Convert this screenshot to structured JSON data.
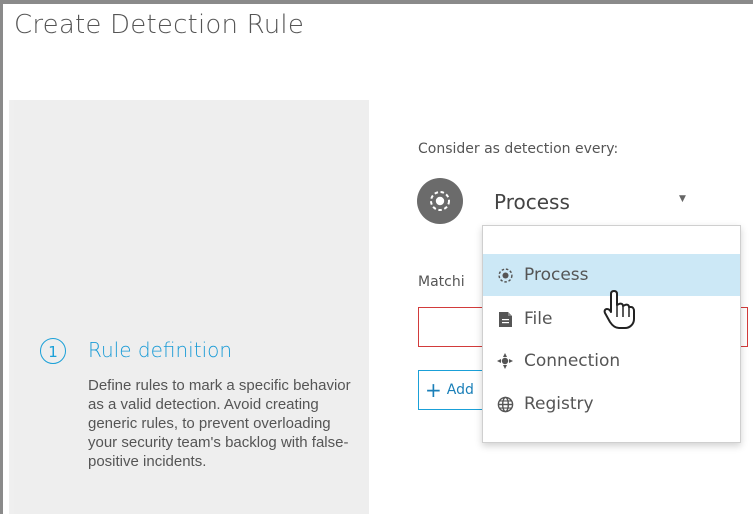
{
  "page": {
    "title": "Create Detection Rule"
  },
  "steps": [
    {
      "number": "1",
      "title": "Rule definition",
      "description": "Define rules to mark a specific behavior as a valid detection. Avoid creating generic rules, to prevent overloading your security team's backlog with false-positive incidents."
    }
  ],
  "form": {
    "consider_label": "Consider as detection every:",
    "selected_type": "Process",
    "selected_icon": "process-icon",
    "matching_label_partial": "Matchi",
    "add_label_partial": "Add"
  },
  "dropdown": {
    "options": [
      {
        "label": "Process",
        "icon": "process-icon",
        "highlighted": true
      },
      {
        "label": "File",
        "icon": "file-icon",
        "highlighted": false
      },
      {
        "label": "Connection",
        "icon": "connection-icon",
        "highlighted": false
      },
      {
        "label": "Registry",
        "icon": "registry-icon",
        "highlighted": false
      }
    ]
  },
  "colors": {
    "accent": "#1aa0d8",
    "highlight": "#cce8f6",
    "error_border": "#d23b3b",
    "panel_background": "#eeeeee"
  }
}
